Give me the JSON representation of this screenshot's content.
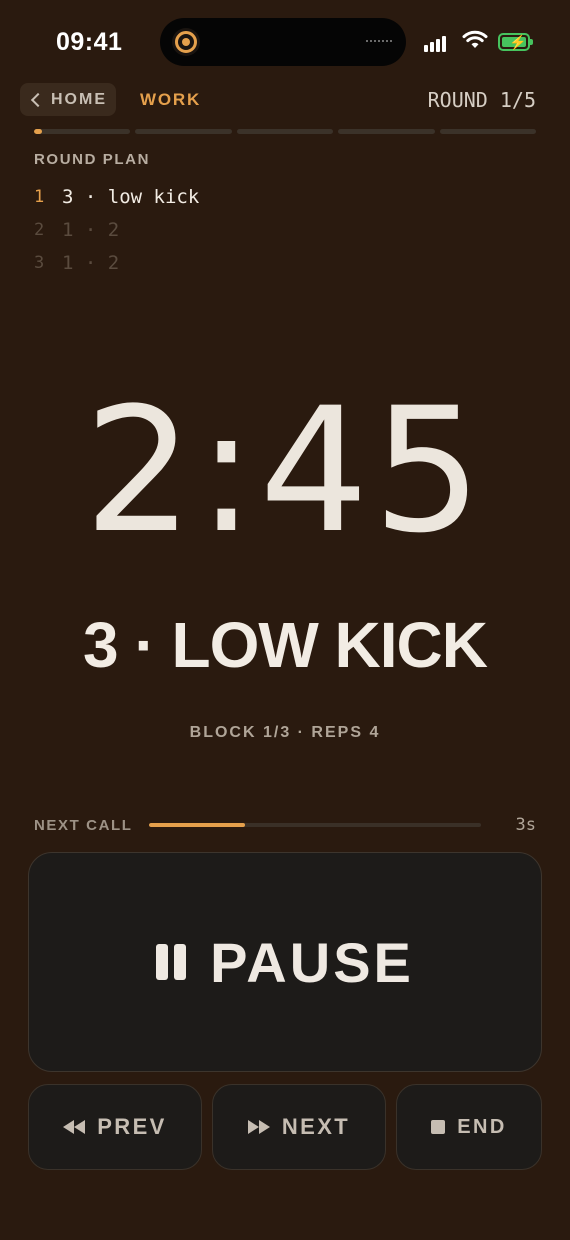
{
  "status_bar": {
    "time": "09:41",
    "battery_level": 0.9
  },
  "header": {
    "home_label": "HOME",
    "phase_label": "WORK",
    "round_counter": "ROUND 1/5",
    "round_progress": {
      "total_rounds": 5,
      "current_round_progress": 0.08
    }
  },
  "round_plan": {
    "title": "ROUND PLAN",
    "items": [
      {
        "index": "1",
        "text": "3 · low kick",
        "active": true
      },
      {
        "index": "2",
        "text": "1 · 2",
        "active": false
      },
      {
        "index": "3",
        "text": "1 · 2",
        "active": false
      }
    ]
  },
  "timer": {
    "display": "2:45"
  },
  "current_call": "3 · LOW KICK",
  "block_info": "BLOCK 1/3 · REPS 4",
  "next_call": {
    "label": "NEXT CALL",
    "seconds": "3s",
    "progress": 0.29
  },
  "controls": {
    "pause_label": "PAUSE",
    "prev_label": "PREV",
    "next_label": "NEXT",
    "end_label": "END"
  },
  "colors": {
    "background": "#2a1a0f",
    "accent": "#e5a04c",
    "button_bg": "#1d1b19",
    "text": "#efe9e2"
  }
}
